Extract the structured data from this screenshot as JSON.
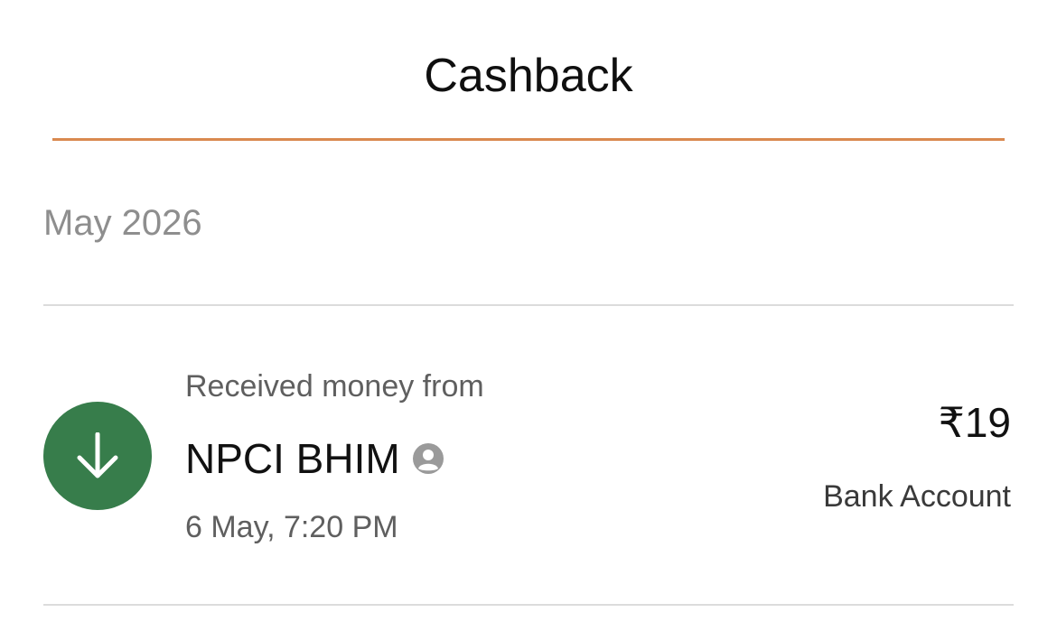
{
  "header": {
    "title": "Cashback",
    "accent_color": "#d9894f"
  },
  "section": {
    "heading": "May 2026"
  },
  "transactions": [
    {
      "subtitle": "Received money from",
      "name": "NPCI BHIM",
      "datetime": "6 May, 7:20 PM",
      "amount": "₹19",
      "account": "Bank Account",
      "direction_icon": "arrow-down-icon",
      "status_color": "#377d4b",
      "name_badge_icon": "user-circle-icon"
    }
  ]
}
